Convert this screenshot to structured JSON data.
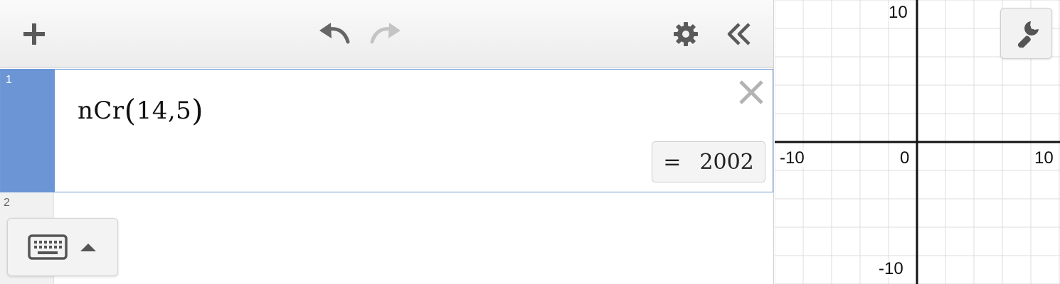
{
  "toolbar": {
    "add_icon": "plus-icon",
    "undo_icon": "undo-icon",
    "redo_icon": "redo-icon",
    "settings_icon": "gear-icon",
    "collapse_icon": "double-chevron-left-icon"
  },
  "expressions": [
    {
      "index": "1",
      "func": "nCr",
      "open_paren": "(",
      "args": "14,5",
      "close_paren": ")",
      "equals": "=",
      "result": "2002"
    },
    {
      "index": "2"
    }
  ],
  "keypad": {
    "keyboard_icon": "keyboard-icon",
    "toggle_icon": "caret-up-icon"
  },
  "graph": {
    "x_min_label": "-10",
    "x_max_label": "10",
    "y_max_label": "10",
    "y_min_label": "-10",
    "origin_label": "0",
    "tool_icon": "wrench-icon"
  },
  "colors": {
    "accent": "#6b95d4",
    "axis": "#111111",
    "grid": "#dcdcdc"
  }
}
